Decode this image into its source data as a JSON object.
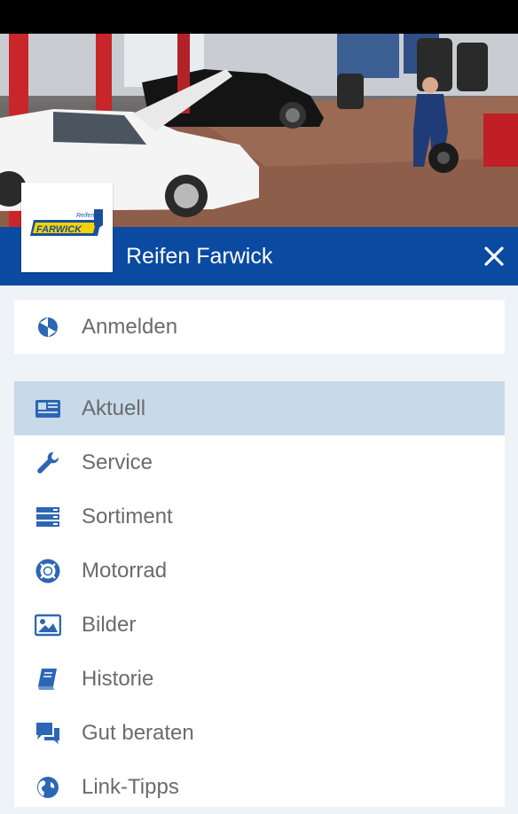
{
  "app": {
    "title": "Reifen Farwick",
    "logo_text_top": "Reifen",
    "logo_text_main": "FARWICK",
    "close_icon": "close-icon"
  },
  "colors": {
    "header_blue": "#0a4aa0",
    "icon_blue": "#2c66b5",
    "active_bg": "#c8d9ea",
    "page_bg": "#eef3f8",
    "label_gray": "#6b6b6b"
  },
  "login": {
    "label": "Anmelden",
    "icon": "login-icon"
  },
  "menu": {
    "items": [
      {
        "label": "Aktuell",
        "icon": "newspaper-icon",
        "active": true
      },
      {
        "label": "Service",
        "icon": "wrench-icon",
        "active": false
      },
      {
        "label": "Sortiment",
        "icon": "list-icon",
        "active": false
      },
      {
        "label": "Motorrad",
        "icon": "lifebuoy-icon",
        "active": false
      },
      {
        "label": "Bilder",
        "icon": "image-icon",
        "active": false
      },
      {
        "label": "Historie",
        "icon": "book-icon",
        "active": false
      },
      {
        "label": "Gut beraten",
        "icon": "chat-icon",
        "active": false
      },
      {
        "label": "Link-Tipps",
        "icon": "globe-icon",
        "active": false
      }
    ]
  }
}
